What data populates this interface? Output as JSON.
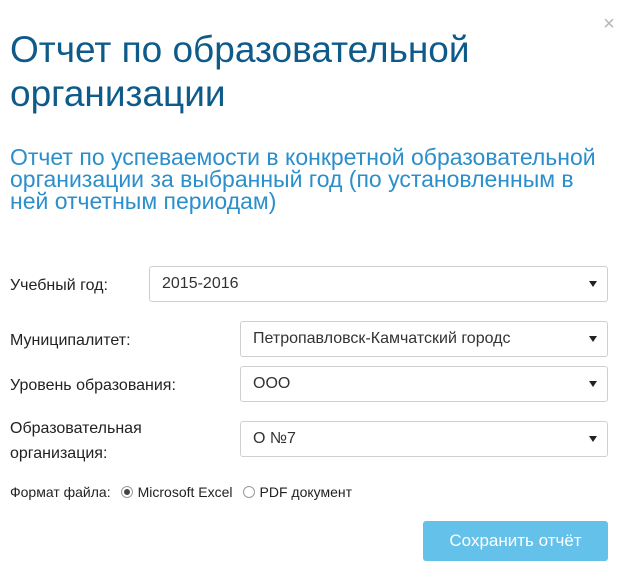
{
  "dialog": {
    "close_symbol": "×",
    "title": "Отчет по образовательной организации",
    "subtitle": "Отчет по успеваемости в конкретной образовательной организации за выбранный год (по установленным в ней отчетным периодам)"
  },
  "form": {
    "academic_year": {
      "label": "Учебный год:",
      "value": "2015-2016"
    },
    "municipality": {
      "label": "Муниципалитет:",
      "value": "Петропавловск-Камчатский городс"
    },
    "education_level": {
      "label": "Уровень образования:",
      "value": "ООО"
    },
    "organization": {
      "label_line1": "Образовательная",
      "label_line2": "организация:",
      "value": "О №7"
    },
    "file_format": {
      "label": "Формат файла:",
      "options": [
        {
          "label": "Microsoft Excel",
          "checked": true
        },
        {
          "label": "PDF документ",
          "checked": false
        }
      ]
    },
    "save_label": "Сохранить отчёт"
  },
  "colors": {
    "title": "#0e5a8a",
    "subtitle": "#2b8fcc",
    "button": "#63c1ea"
  },
  "icons": {
    "close": "close-icon",
    "dropdown": "chevron-down-icon",
    "radio": "radio-icon"
  }
}
